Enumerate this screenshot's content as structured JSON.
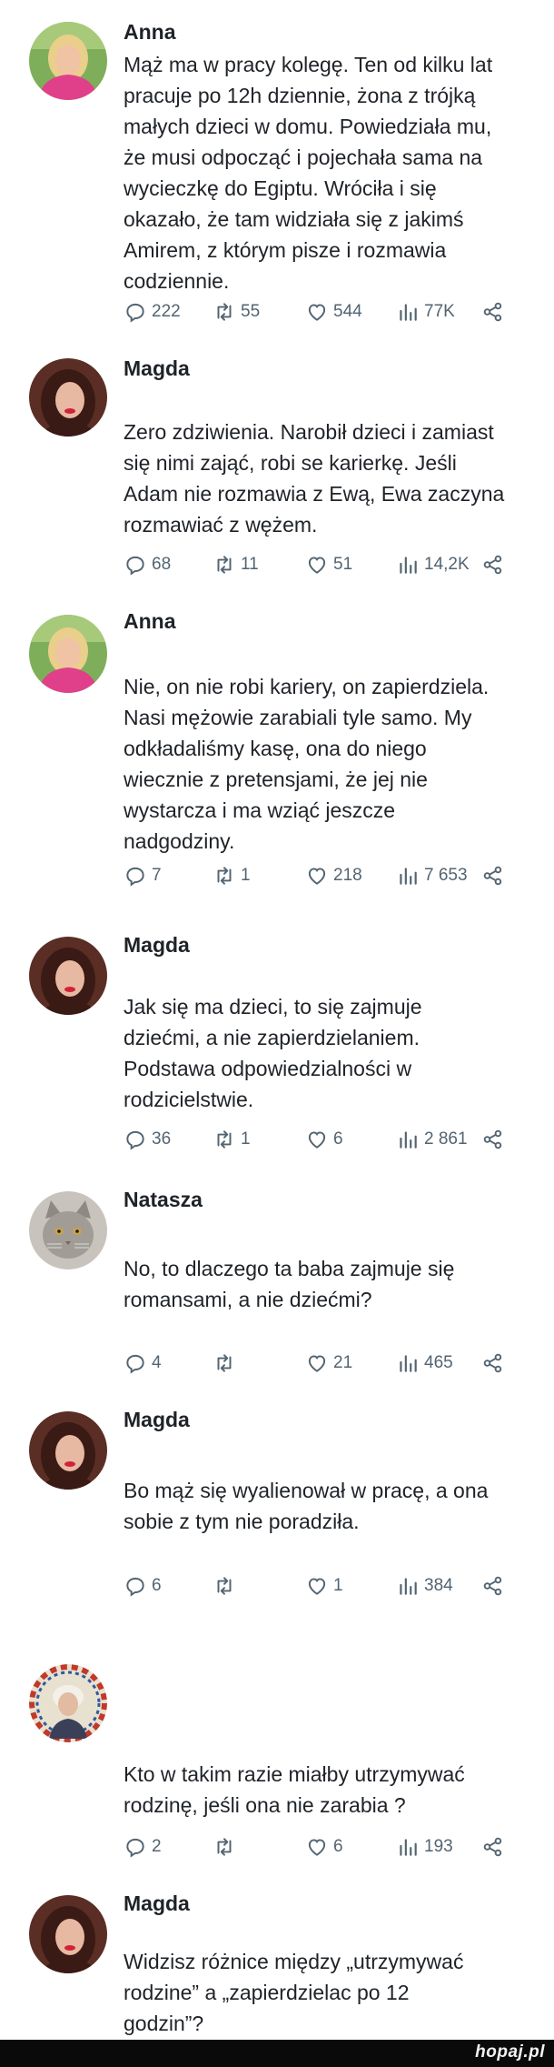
{
  "posts": [
    {
      "author": "Anna",
      "avatar": "woman-blonde-pink",
      "lines": [
        "Mąż ma w pracy kolegę. Ten od kilku lat",
        "pracuje po 12h dziennie, żona z trójką",
        "małych dzieci w domu. Powiedziała mu,",
        "że musi odpocząć i pojechała sama na",
        "wycieczkę do Egiptu. Wróciła i się",
        "okazało, że tam widziała się z jakimś",
        "Amirem, z którym pisze i rozmawia",
        "codziennie."
      ],
      "replies": "222",
      "reposts": "55",
      "likes": "544",
      "views": "77K"
    },
    {
      "author": "Magda",
      "avatar": "woman-dark-hair",
      "lines": [
        "Zero zdziwienia. Narobił dzieci i zamiast",
        "się nimi zająć, robi se karierkę. Jeśli",
        "Adam nie rozmawia z Ewą, Ewa zaczyna",
        "rozmawiać z wężem."
      ],
      "replies": "68",
      "reposts": "11",
      "likes": "51",
      "views": "14,2K"
    },
    {
      "author": "Anna",
      "avatar": "woman-blonde-pink",
      "lines": [
        "Nie, on nie robi kariery, on zapierdziela.",
        "Nasi mężowie zarabiali tyle samo. My",
        "odkładaliśmy kasę, ona do niego",
        "wiecznie z pretensjami, że jej nie",
        "wystarcza i ma wziąć jeszcze",
        "nadgodziny."
      ],
      "replies": "7",
      "reposts": "1",
      "likes": "218",
      "views": "7 653"
    },
    {
      "author": "Magda",
      "avatar": "woman-dark-hair",
      "lines": [
        "Jak się ma dzieci, to się zajmuje",
        "dziećmi, a nie zapierdzielaniem.",
        "Podstawa odpowiedzialności w",
        "rodzicielstwie."
      ],
      "replies": "36",
      "reposts": "1",
      "likes": "6",
      "views": "2 861"
    },
    {
      "author": "Natasza",
      "avatar": "grey-cat",
      "lines": [
        "No, to dlaczego ta baba zajmuje się",
        "romansami, a nie dziećmi?"
      ],
      "replies": "4",
      "reposts": "",
      "likes": "21",
      "views": "465"
    },
    {
      "author": "Magda",
      "avatar": "woman-dark-hair",
      "lines": [
        "Bo mąż się wyalienował w pracę, a ona",
        "sobie z tym nie poradziła."
      ],
      "replies": "6",
      "reposts": "",
      "likes": "1",
      "views": "384"
    },
    {
      "author": "",
      "avatar": "classical-portrait",
      "lines": [
        "Kto w takim razie miałby utrzymywać",
        "rodzinę, jeśli ona nie zarabia ?"
      ],
      "replies": "2",
      "reposts": "",
      "likes": "6",
      "views": "193"
    },
    {
      "author": "Magda",
      "avatar": "woman-dark-hair",
      "lines": [
        "Widzisz różnice między „utrzymywać",
        "rodzine” a „zapierdzielac po 12",
        "godzin”?"
      ]
    }
  ],
  "icons": {
    "reply": "reply-icon",
    "repost": "repost-icon",
    "like": "like-icon",
    "views": "views-icon",
    "share": "share-icon"
  },
  "colors": {
    "text": "#1f2328",
    "meta": "#536471",
    "footer": "#0a0a0a"
  },
  "footer": {
    "logo": "hopaj.pl"
  }
}
